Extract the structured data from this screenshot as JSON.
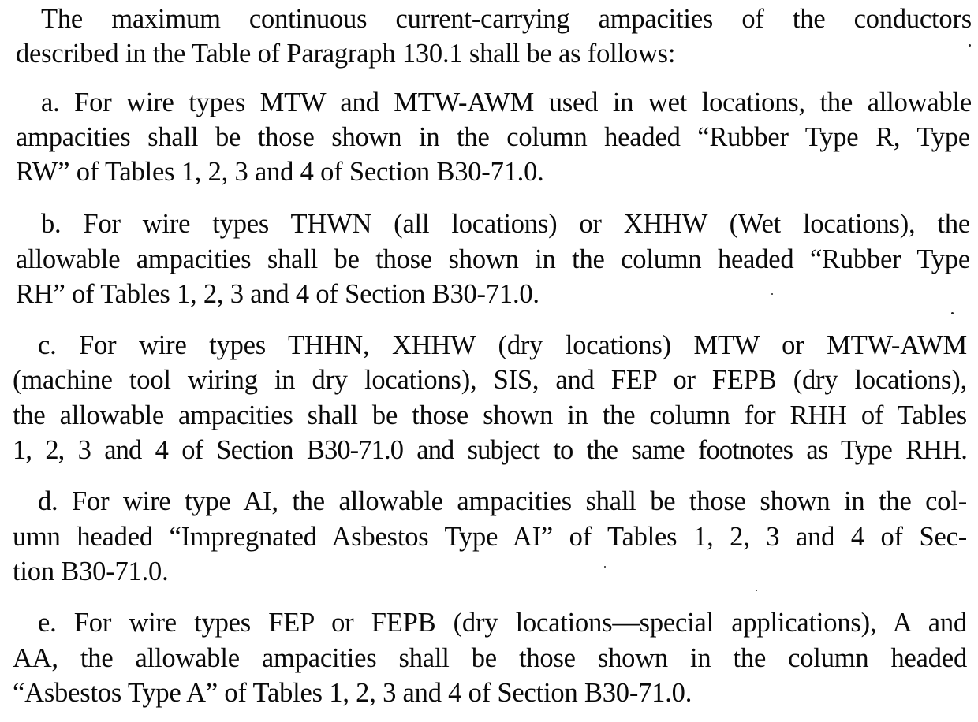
{
  "document": {
    "intro": [
      "The maximum continuous current-carrying ampacities of the conductors",
      "described in the Table of Paragraph 130.1 shall be as follows:"
    ],
    "items": [
      {
        "lines": [
          "a. For wire types MTW and MTW-AWM used in wet locations, the allowable",
          "ampacities shall be those shown in the column headed “Rubber Type R, Type",
          "RW” of Tables 1, 2, 3 and 4 of Section B30-71.0."
        ]
      },
      {
        "lines": [
          "b. For wire types THWN (all locations) or XHHW (Wet locations), the",
          "allowable ampacities shall be those shown in the column headed “Rubber Type",
          "RH” of Tables 1, 2, 3 and 4 of Section B30-71.0."
        ]
      },
      {
        "lines": [
          "c. For wire types THHN, XHHW (dry locations) MTW or MTW-AWM",
          "(machine tool wiring in dry locations), SIS, and FEP or FEPB (dry locations),",
          "the allowable ampacities shall be those shown in the column for RHH of Tables",
          "1, 2, 3 and 4 of Section B30-71.0 and subject to the same footnotes as Type RHH."
        ]
      },
      {
        "lines": [
          "d. For wire type AI, the allowable ampacities shall be those shown in the col-",
          "umn headed “Impregnated Asbestos Type AI” of Tables 1, 2, 3 and 4 of Sec-",
          "tion B30-71.0."
        ]
      },
      {
        "lines": [
          "e. For wire types FEP or FEPB (dry locations—special applications), A and",
          "AA, the allowable ampacities shall be those shown in the column headed",
          "“Asbestos Type A” of Tables 1, 2, 3 and 4 of Section B30-71.0."
        ]
      }
    ]
  }
}
